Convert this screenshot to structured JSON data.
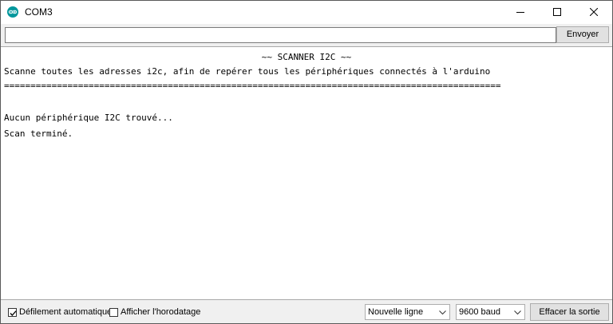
{
  "window": {
    "title": "COM3",
    "icon": "arduino-logo-icon",
    "controls": [
      "minimize-icon",
      "maximize-icon",
      "close-icon"
    ]
  },
  "send_bar": {
    "input_value": "",
    "send_label": "Envoyer"
  },
  "output": {
    "lines": [
      "~~ SCANNER I2C ~~",
      "Scanne toutes les adresses i2c, afin de repérer tous les périphériques connectés à l'arduino",
      "==============================================================================================",
      "",
      "Aucun périphérique I2C trouvé...",
      "Scan terminé."
    ]
  },
  "footer": {
    "autoscroll_label": "Défilement automatique",
    "autoscroll_checked": true,
    "timestamp_label": "Afficher l'horodatage",
    "timestamp_checked": false,
    "line_ending_value": "Nouvelle ligne",
    "baud_value": "9600 baud",
    "clear_label": "Effacer la sortie"
  },
  "colors": {
    "app_icon": "#00979c",
    "window_bg": "#f0f0f0",
    "output_bg": "#ffffff"
  }
}
